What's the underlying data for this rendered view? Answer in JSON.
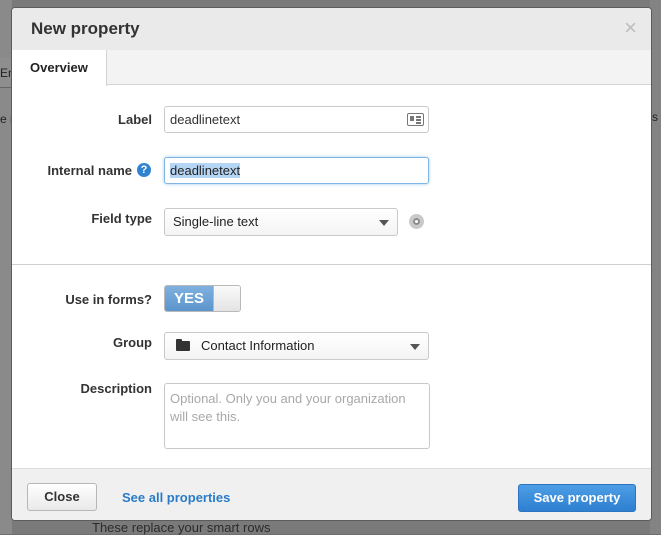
{
  "background": {
    "tab_fragment": "En",
    "left_fragment": "e n",
    "right_fragment": "s",
    "bottom_text": "These replace your smart rows"
  },
  "modal": {
    "title": "New property",
    "close_glyph": "×"
  },
  "tabs": [
    {
      "label": "Overview",
      "active": true
    }
  ],
  "form": {
    "label_field": {
      "label": "Label",
      "value": "deadlinetext"
    },
    "internal_name": {
      "label": "Internal name",
      "value": "deadlinetext",
      "help_glyph": "?"
    },
    "field_type": {
      "label": "Field type",
      "selected": "Single-line text"
    },
    "use_in_forms": {
      "label": "Use in forms?",
      "toggle_text": "YES",
      "on": true
    },
    "group": {
      "label": "Group",
      "selected": "Contact Information"
    },
    "description": {
      "label": "Description",
      "placeholder": "Optional. Only you and your organization will see this."
    }
  },
  "footer": {
    "close_label": "Close",
    "see_all_label": "See all properties",
    "save_label": "Save property"
  },
  "colors": {
    "accent": "#2d7fd0",
    "link": "#2a7cc6",
    "toggle_on": "#6aa3d8"
  },
  "icons": {
    "label_field": "contact-card-icon",
    "internal_name": "help-icon",
    "field_type": "eye-icon",
    "group": "folder-icon"
  }
}
